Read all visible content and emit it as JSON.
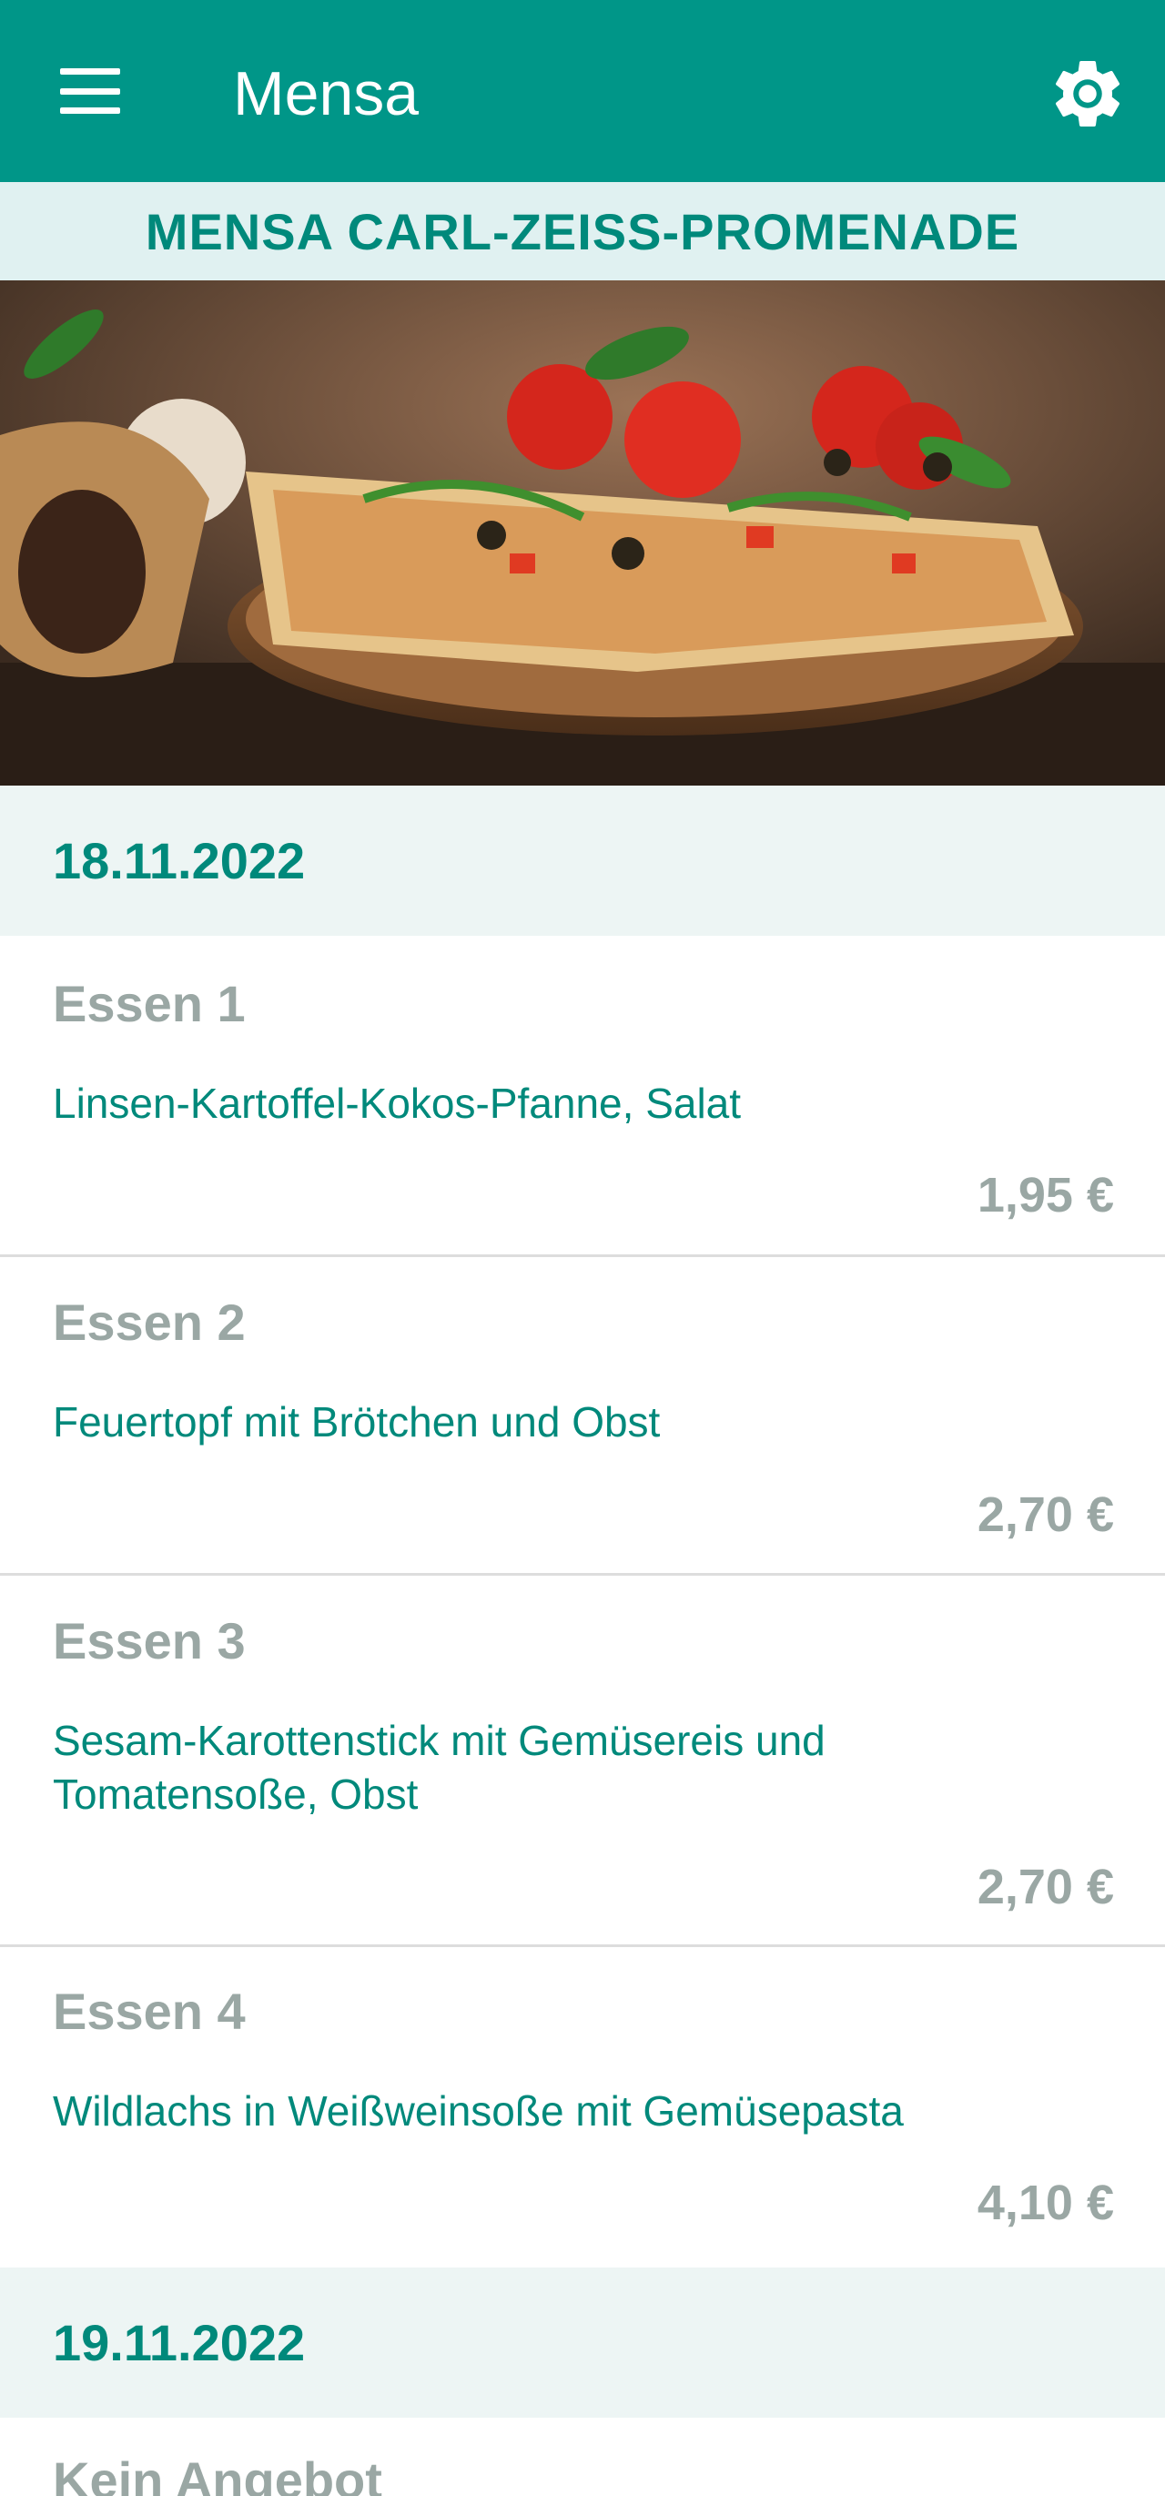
{
  "app_bar": {
    "title": "Mensa",
    "menu_icon": "hamburger-menu-icon",
    "settings_icon": "gear-icon",
    "background": "#009688"
  },
  "location": {
    "name": "MENSA CARL-ZEISS-PROMENADE"
  },
  "days": [
    {
      "date": "18.11.2022",
      "meals": [
        {
          "name": "Essen 1",
          "description": "Linsen-Kartoffel-Kokos-Pfanne, Salat",
          "price": "1,95 €"
        },
        {
          "name": "Essen 2",
          "description": "Feuertopf mit Brötchen und Obst",
          "price": "2,70 €"
        },
        {
          "name": "Essen 3",
          "description": "Sesam-Karottenstick mit Gemüsereis und Tomatensoße, Obst",
          "price": "2,70 €"
        },
        {
          "name": "Essen 4",
          "description": "Wildlachs in Weißweinsoße mit Gemüsepasta",
          "price": "4,10 €"
        }
      ]
    },
    {
      "date": "19.11.2022",
      "no_offer": "Kein Angebot"
    }
  ],
  "colors": {
    "primary": "#009688",
    "accent_text": "#00897b",
    "muted_text": "#9aa7a4",
    "subheader_bg": "#e0f1f1",
    "day_bg": "#edf5f4"
  }
}
